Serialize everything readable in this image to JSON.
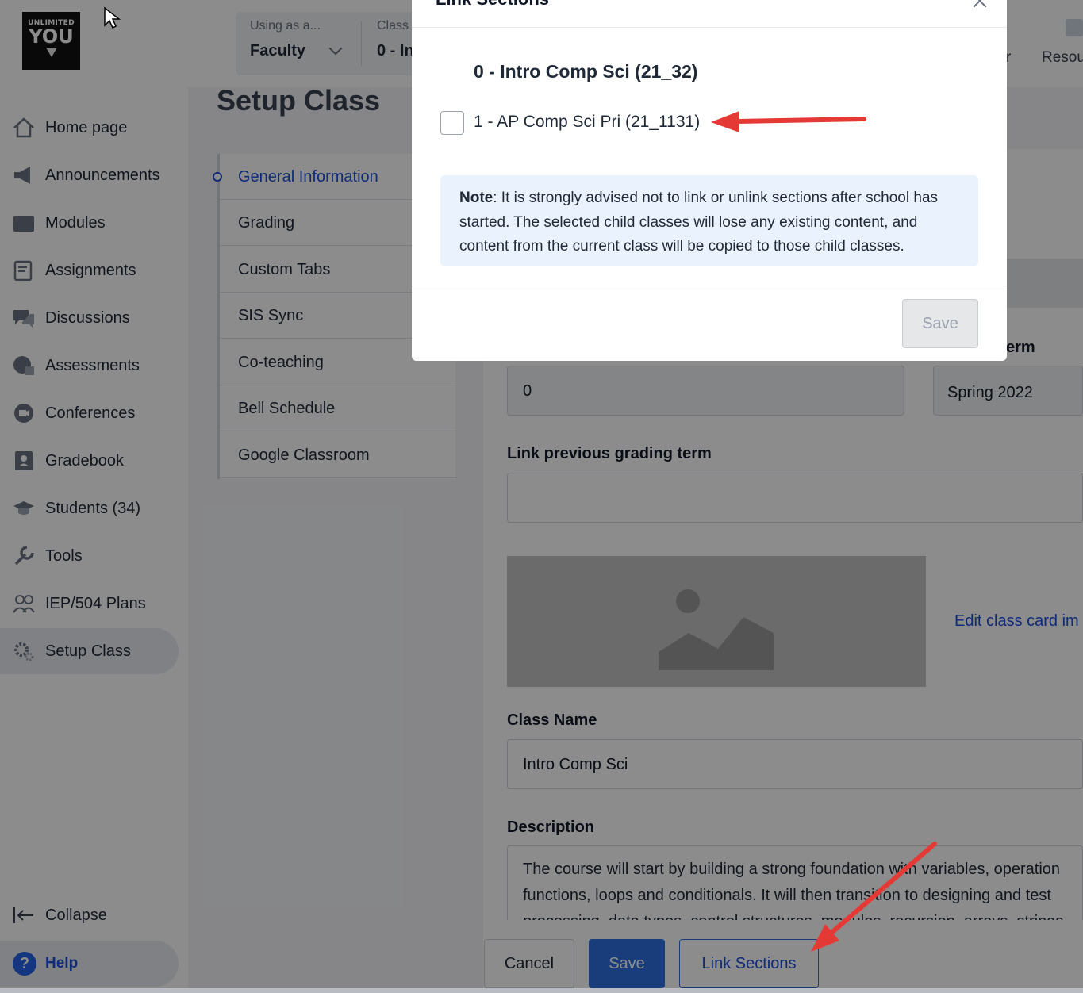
{
  "logo": {
    "line1": "UNLIMITED",
    "line2": "YOU"
  },
  "context": {
    "role_label": "Using as a...",
    "role_value": "Faculty",
    "class_label": "Class",
    "class_value": "0 - In"
  },
  "topbar_right": {
    "label_1": "r",
    "label_2": "Resou"
  },
  "sidebar": {
    "items": [
      {
        "label": "Home page",
        "icon": "home-icon"
      },
      {
        "label": "Announcements",
        "icon": "megaphone-icon"
      },
      {
        "label": "Modules",
        "icon": "folder-icon"
      },
      {
        "label": "Assignments",
        "icon": "assignment-icon"
      },
      {
        "label": "Discussions",
        "icon": "chat-icon"
      },
      {
        "label": "Assessments",
        "icon": "assessment-icon"
      },
      {
        "label": "Conferences",
        "icon": "video-icon"
      },
      {
        "label": "Gradebook",
        "icon": "gradebook-icon"
      },
      {
        "label": "Students (34)",
        "icon": "graduation-cap-icon"
      },
      {
        "label": "Tools",
        "icon": "wrench-icon"
      },
      {
        "label": "IEP/504 Plans",
        "icon": "people-icon"
      },
      {
        "label": "Setup Class",
        "icon": "gear-icon"
      }
    ],
    "collapse": "Collapse",
    "help": "Help"
  },
  "page": {
    "title": "Setup Class",
    "subnav": [
      "General Information",
      "Grading",
      "Custom Tabs",
      "SIS Sync",
      "Co-teaching",
      "Bell Schedule",
      "Google Classroom"
    ]
  },
  "form": {
    "term_label_partial": "erm",
    "section_value": "0",
    "term_value": "Spring 2022",
    "link_prev_label": "Link previous grading term",
    "edit_card_link": "Edit class card im",
    "class_name_label": "Class Name",
    "class_name_value": "Intro Comp Sci",
    "description_label": "Description",
    "description_lines": [
      "The course will start by building a strong foundation with variables, operation",
      "functions, loops and conditionals. It will then transition to designing and test",
      "processing, data types, control structures, modules, recursion, arrays, strings"
    ]
  },
  "footer": {
    "cancel": "Cancel",
    "save": "Save",
    "link_sections": "Link Sections"
  },
  "modal": {
    "title": "Link Sections",
    "parent": "0 - Intro Comp Sci (21_32)",
    "child": "1 - AP Comp Sci Pri (21_1131)",
    "child_checked": false,
    "note_label": "Note",
    "note_text": ": It is strongly advised not to link or unlink sections after school has started. The selected child classes will lose any existing content, and content from the current class will be copied to those child classes.",
    "save": "Save"
  },
  "colors": {
    "accent": "#2f6fde",
    "link": "#1d4ed8",
    "annotation_arrow": "#e53935",
    "note_bg": "#eaf2fd"
  }
}
